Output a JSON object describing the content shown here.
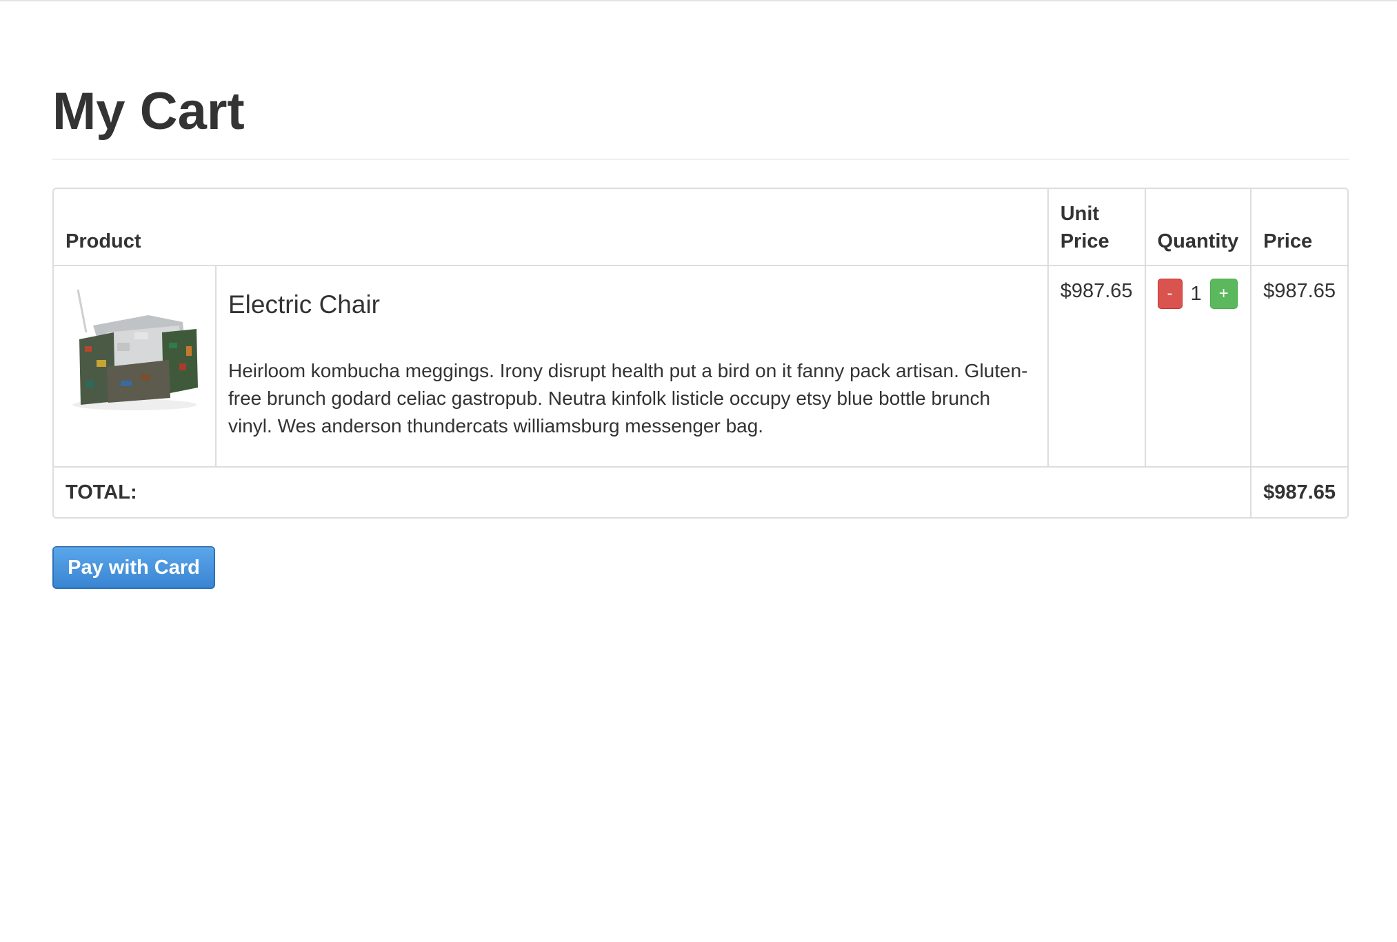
{
  "page": {
    "title": "My Cart"
  },
  "table": {
    "headers": {
      "product": "Product",
      "unit_price": "Unit\nPrice",
      "quantity": "Quantity",
      "price": "Price"
    },
    "items": [
      {
        "name": "Electric Chair",
        "description": "Heirloom kombucha meggings. Irony disrupt health put a bird on it fanny pack artisan. Gluten-free brunch godard celiac gastropub. Neutra kinfolk listicle occupy etsy blue bottle brunch vinyl. Wes anderson thundercats williamsburg messenger bag.",
        "unit_price": "$987.65",
        "quantity": "1",
        "decrement_label": "-",
        "increment_label": "+",
        "price": "$987.65",
        "image": "chair-product-image"
      }
    ],
    "total_label": "TOTAL:",
    "total_value": "$987.65"
  },
  "actions": {
    "pay_label": "Pay with Card"
  },
  "colors": {
    "decrement": "#d9534f",
    "increment": "#5cb85c",
    "primary": "#428bca"
  }
}
